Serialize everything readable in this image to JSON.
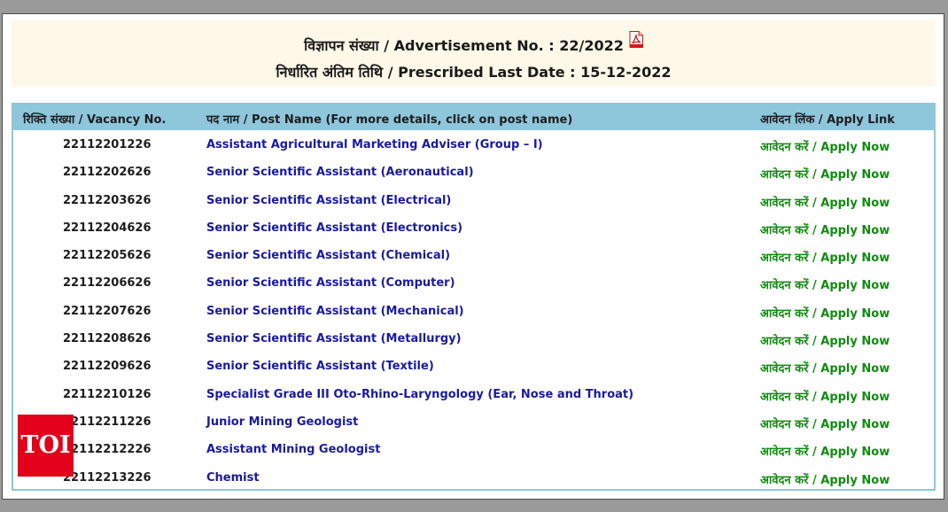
{
  "header": {
    "line1": "विज्ञापन संख्या / Advertisement No. : 22/2022",
    "pdf_icon": "pdf-file-icon",
    "line2": "निर्धारित अंतिम तिथि / Prescribed Last Date : 15-12-2022"
  },
  "table": {
    "columns": [
      "रिक्ति संख्या / Vacancy No.",
      "पद नाम / Post Name (For more details, click on post name)",
      "आवेदन लिंक / Apply Link"
    ],
    "rows": [
      {
        "vacancy": "22112201226",
        "post": "Assistant Agricultural Marketing Adviser (Group – I)",
        "apply": "आवेदन करें / Apply Now"
      },
      {
        "vacancy": "22112202626",
        "post": "Senior Scientific Assistant (Aeronautical)",
        "apply": "आवेदन करें / Apply Now"
      },
      {
        "vacancy": "22112203626",
        "post": "Senior Scientific Assistant (Electrical)",
        "apply": "आवेदन करें / Apply Now"
      },
      {
        "vacancy": "22112204626",
        "post": "Senior Scientific Assistant (Electronics)",
        "apply": "आवेदन करें / Apply Now"
      },
      {
        "vacancy": "22112205626",
        "post": "Senior Scientific Assistant (Chemical)",
        "apply": "आवेदन करें / Apply Now"
      },
      {
        "vacancy": "22112206626",
        "post": "Senior Scientific Assistant (Computer)",
        "apply": "आवेदन करें / Apply Now"
      },
      {
        "vacancy": "22112207626",
        "post": "Senior Scientific Assistant (Mechanical)",
        "apply": "आवेदन करें / Apply Now"
      },
      {
        "vacancy": "22112208626",
        "post": "Senior Scientific Assistant (Metallurgy)",
        "apply": "आवेदन करें / Apply Now"
      },
      {
        "vacancy": "22112209626",
        "post": "Senior Scientific Assistant (Textile)",
        "apply": "आवेदन करें / Apply Now"
      },
      {
        "vacancy": "22112210126",
        "post": "Specialist Grade III Oto-Rhino-Laryngology (Ear, Nose and Throat)",
        "apply": "आवेदन करें / Apply Now"
      },
      {
        "vacancy": "22112211226",
        "post": "Junior Mining Geologist",
        "apply": "आवेदन करें / Apply Now"
      },
      {
        "vacancy": "22112212226",
        "post": "Assistant Mining Geologist",
        "apply": "आवेदन करें / Apply Now"
      },
      {
        "vacancy": "22112213226",
        "post": "Chemist",
        "apply": "आवेदन करें / Apply Now"
      }
    ]
  },
  "watermark": {
    "text": "TOI",
    "color": "#e2001a"
  },
  "colors": {
    "header_bg": "#8ec6dc",
    "post_link": "#1a1aa0",
    "apply_link": "#128a12",
    "banner_bg": "#fdf8e8"
  }
}
